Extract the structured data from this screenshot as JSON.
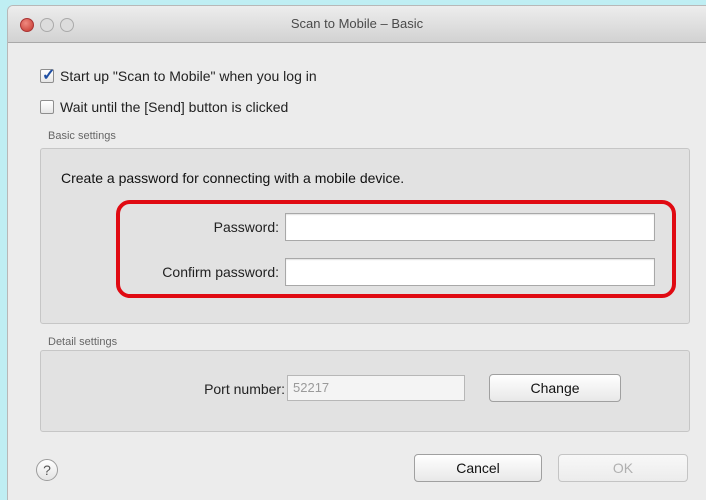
{
  "window": {
    "title": "Scan to Mobile – Basic"
  },
  "options": {
    "startup_label": "Start up \"Scan to Mobile\" when you log in",
    "startup_checked": true,
    "wait_label": "Wait until the [Send] button is clicked",
    "wait_checked": false
  },
  "basic": {
    "group_label": "Basic settings",
    "instruction": "Create a password for connecting with a mobile device.",
    "password_label": "Password:",
    "password_value": "",
    "confirm_label": "Confirm password:",
    "confirm_value": ""
  },
  "detail": {
    "group_label": "Detail settings",
    "port_label": "Port number:",
    "port_value": "52217",
    "change_label": "Change"
  },
  "footer": {
    "help_symbol": "?",
    "cancel_label": "Cancel",
    "ok_label": "OK"
  },
  "colors": {
    "highlight": "#e00a12",
    "background": "#bfeef3"
  }
}
